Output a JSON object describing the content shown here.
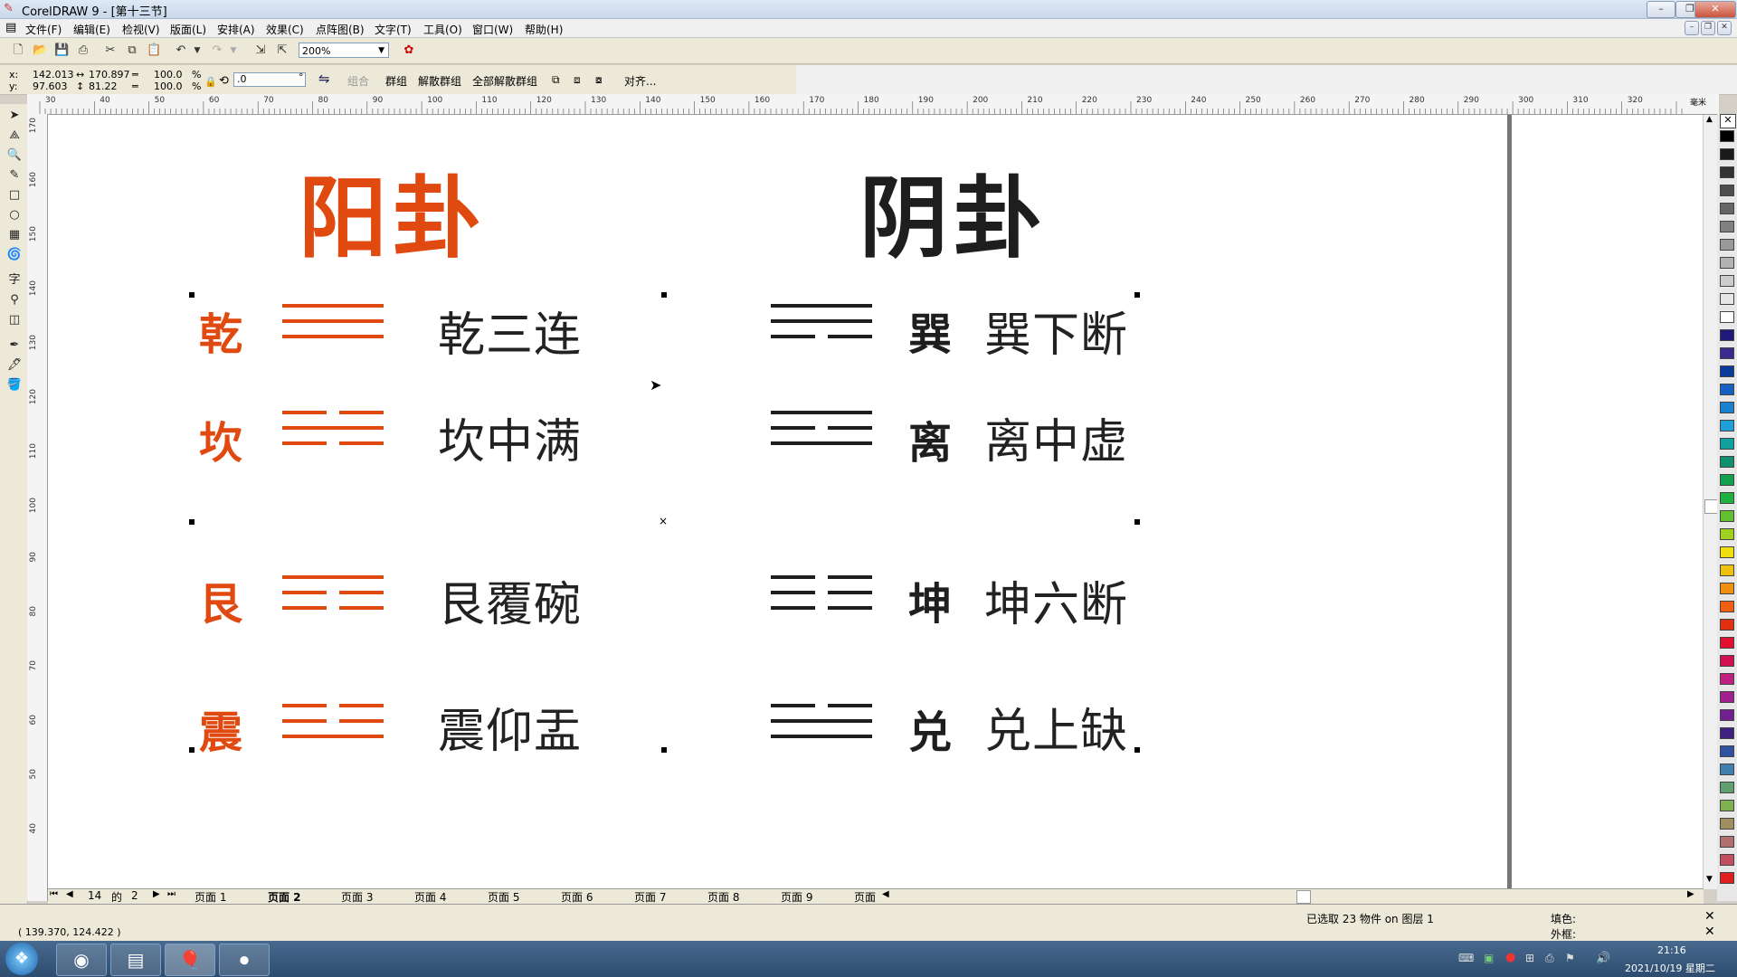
{
  "window": {
    "title": "CorelDRAW 9 - [第十三节]"
  },
  "menu": [
    "文件(F)",
    "编辑(E)",
    "检视(V)",
    "版面(L)",
    "安排(A)",
    "效果(C)",
    "点阵图(B)",
    "文字(T)",
    "工具(O)",
    "窗口(W)",
    "帮助(H)"
  ],
  "toolbar": {
    "zoom": "200%"
  },
  "propbar": {
    "x_label": "x:",
    "x": "142.013",
    "y_label": "y:",
    "y": "97.603",
    "w": "170.897",
    "h": "81.22",
    "scale_x": "100.0",
    "scale_y": "100.0",
    "pct": "%",
    "rotate": ".0",
    "deg": "°",
    "combine": "组合",
    "group": "群组",
    "ungroup": "解散群组",
    "ungroup_all": "全部解散群组",
    "align": "对齐..."
  },
  "ruler": {
    "h_ticks": [
      "30",
      "40",
      "50",
      "60",
      "70",
      "80",
      "90",
      "100",
      "110",
      "120",
      "130",
      "140",
      "150",
      "160",
      "170",
      "180",
      "190",
      "200",
      "210",
      "220",
      "230",
      "240",
      "250",
      "260",
      "270",
      "280",
      "290",
      "300",
      "310",
      "320"
    ],
    "h_unit": "毫米",
    "v_ticks": [
      "170",
      "160",
      "150",
      "140",
      "130",
      "120",
      "110",
      "100",
      "90",
      "80",
      "70",
      "60",
      "50",
      "40"
    ]
  },
  "drawing": {
    "yang_title": "阳卦",
    "yin_title": "阴卦",
    "yang_color": "#e04a10",
    "yin_color": "#1e1e1e",
    "yang": [
      {
        "name": "乾",
        "verse": "乾三连"
      },
      {
        "name": "坎",
        "verse": "坎中满"
      },
      {
        "name": "艮",
        "verse": "艮覆碗"
      },
      {
        "name": "震",
        "verse": "震仰盂"
      }
    ],
    "yin": [
      {
        "name": "巽",
        "verse": "巽下断"
      },
      {
        "name": "离",
        "verse": "离中虚"
      },
      {
        "name": "坤",
        "verse": "坤六断"
      },
      {
        "name": "兑",
        "verse": "兑上缺"
      }
    ]
  },
  "pagenav": {
    "current": "14",
    "of": "的",
    "total": "2"
  },
  "pages": [
    "页面 1",
    "页面 2",
    "页面 3",
    "页面 4",
    "页面 5",
    "页面 6",
    "页面 7",
    "页面 8",
    "页面 9",
    "页面"
  ],
  "status": {
    "coords": "( 139.370, 124.422 )",
    "selection": "已选取 23 物件 on 图层 1",
    "fill_label": "填色:",
    "outline_label": "外框:"
  },
  "taskbar": {
    "time": "21:16",
    "date": "2021/10/19 星期二"
  },
  "palette": [
    "#000000",
    "#1a1a1a",
    "#333333",
    "#4d4d4d",
    "#666666",
    "#808080",
    "#999999",
    "#b3b3b3",
    "#cccccc",
    "#e6e6e6",
    "#ffffff",
    "#1f1a7a",
    "#3a2a8f",
    "#0a3a9a",
    "#1560c0",
    "#1a80d0",
    "#20a0d8",
    "#10a0a0",
    "#109070",
    "#10a050",
    "#20b040",
    "#60c030",
    "#a0d020",
    "#f0e010",
    "#f0c010",
    "#f09010",
    "#f06010",
    "#e03010",
    "#e01030",
    "#d01050",
    "#c02080",
    "#a02090",
    "#702090",
    "#402080",
    "#3050a0",
    "#4080b0",
    "#60a070",
    "#80b050",
    "#a09060",
    "#b07070",
    "#c05060",
    "#e02020"
  ]
}
